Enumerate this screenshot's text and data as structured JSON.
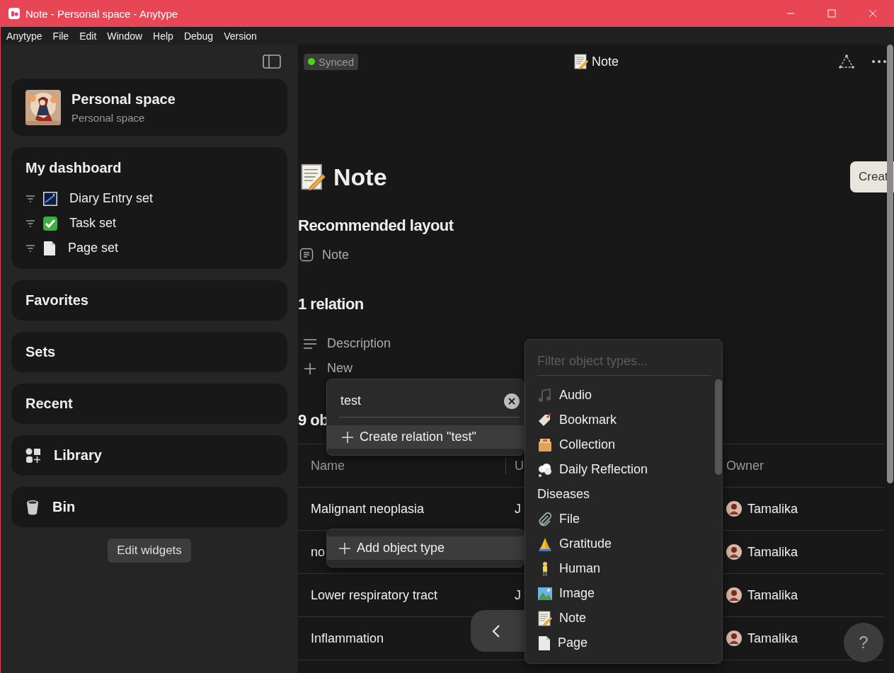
{
  "window": {
    "title": "Note - Personal space - Anytype"
  },
  "menu": [
    "Anytype",
    "File",
    "Edit",
    "Window",
    "Help",
    "Debug",
    "Version"
  ],
  "sidebar": {
    "space": {
      "name": "Personal space",
      "subtitle": "Personal space"
    },
    "dashboard": {
      "title": "My dashboard",
      "items": [
        "Diary Entry set",
        "Task set",
        "Page set"
      ]
    },
    "widgets": [
      {
        "label": "Favorites",
        "kind": "plain"
      },
      {
        "label": "Sets",
        "kind": "plain"
      },
      {
        "label": "Recent",
        "kind": "plain"
      },
      {
        "label": "Library",
        "kind": "library"
      },
      {
        "label": "Bin",
        "kind": "bin"
      }
    ],
    "edit_button": "Edit widgets"
  },
  "header": {
    "status": "Synced",
    "title": "Note"
  },
  "page": {
    "title": "Note",
    "create_button": "Creat",
    "layout_heading": "Recommended layout",
    "layout": "Note",
    "relations_heading": "1 relation",
    "relations": [
      "Description"
    ],
    "new_label": "New",
    "objects_heading": "9 ob",
    "table": {
      "columns": [
        "Name",
        "U",
        "Owner"
      ],
      "rows": [
        {
          "name": "Malignant neoplasia",
          "column_2": "J",
          "owner": "Tamalika"
        },
        {
          "name": "no",
          "owner": "Tamalika"
        },
        {
          "name": "Lower respiratory tract",
          "column_2": "J",
          "owner": "Tamalika"
        },
        {
          "name": "Inflammation",
          "owner": "Tamalika"
        }
      ]
    }
  },
  "relation_search": {
    "value": "test",
    "create_label": "Create relation \"test\""
  },
  "add_type_button": "Add object type",
  "type_menu": {
    "placeholder": "Filter object types...",
    "items": [
      {
        "label": "Audio",
        "kind": "type"
      },
      {
        "label": "Bookmark",
        "kind": "type"
      },
      {
        "label": "Collection",
        "kind": "type"
      },
      {
        "label": "Daily Reflection",
        "kind": "type"
      },
      {
        "label": "Diseases",
        "kind": "plain"
      },
      {
        "label": "File",
        "kind": "type"
      },
      {
        "label": "Gratitude",
        "kind": "type"
      },
      {
        "label": "Human",
        "kind": "type"
      },
      {
        "label": "Image",
        "kind": "type"
      },
      {
        "label": "Note",
        "kind": "type"
      },
      {
        "label": "Page",
        "kind": "type"
      }
    ]
  },
  "help_button": "?"
}
